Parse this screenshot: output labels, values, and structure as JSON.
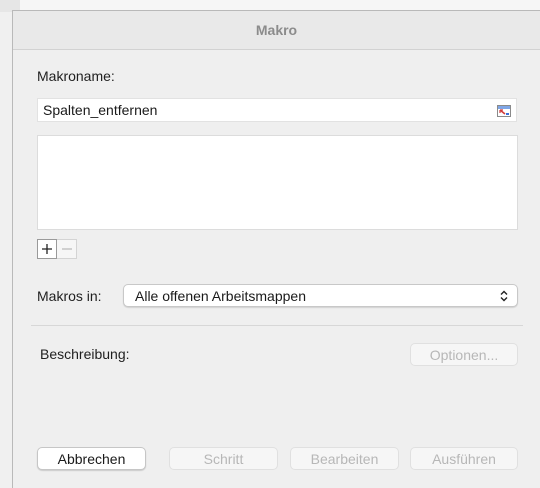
{
  "dialog": {
    "title": "Makro"
  },
  "macro_name": {
    "label": "Makroname:",
    "value": "Spalten_entfernen"
  },
  "macro_list": {
    "items": []
  },
  "list_controls": {
    "add_label": "+",
    "remove_label": "−"
  },
  "macros_in": {
    "label": "Makros in:",
    "selected": "Alle offenen Arbeitsmappen"
  },
  "description": {
    "label": "Beschreibung:"
  },
  "buttons": {
    "options": "Optionen...",
    "cancel": "Abbrechen",
    "step": "Schritt",
    "edit": "Bearbeiten",
    "run": "Ausführen"
  },
  "colors": {
    "dialog_bg": "#efefef",
    "disabled_text": "#b7b7b7",
    "field_icon_red": "#d23b3b",
    "field_icon_blue": "#3a6fd8"
  }
}
